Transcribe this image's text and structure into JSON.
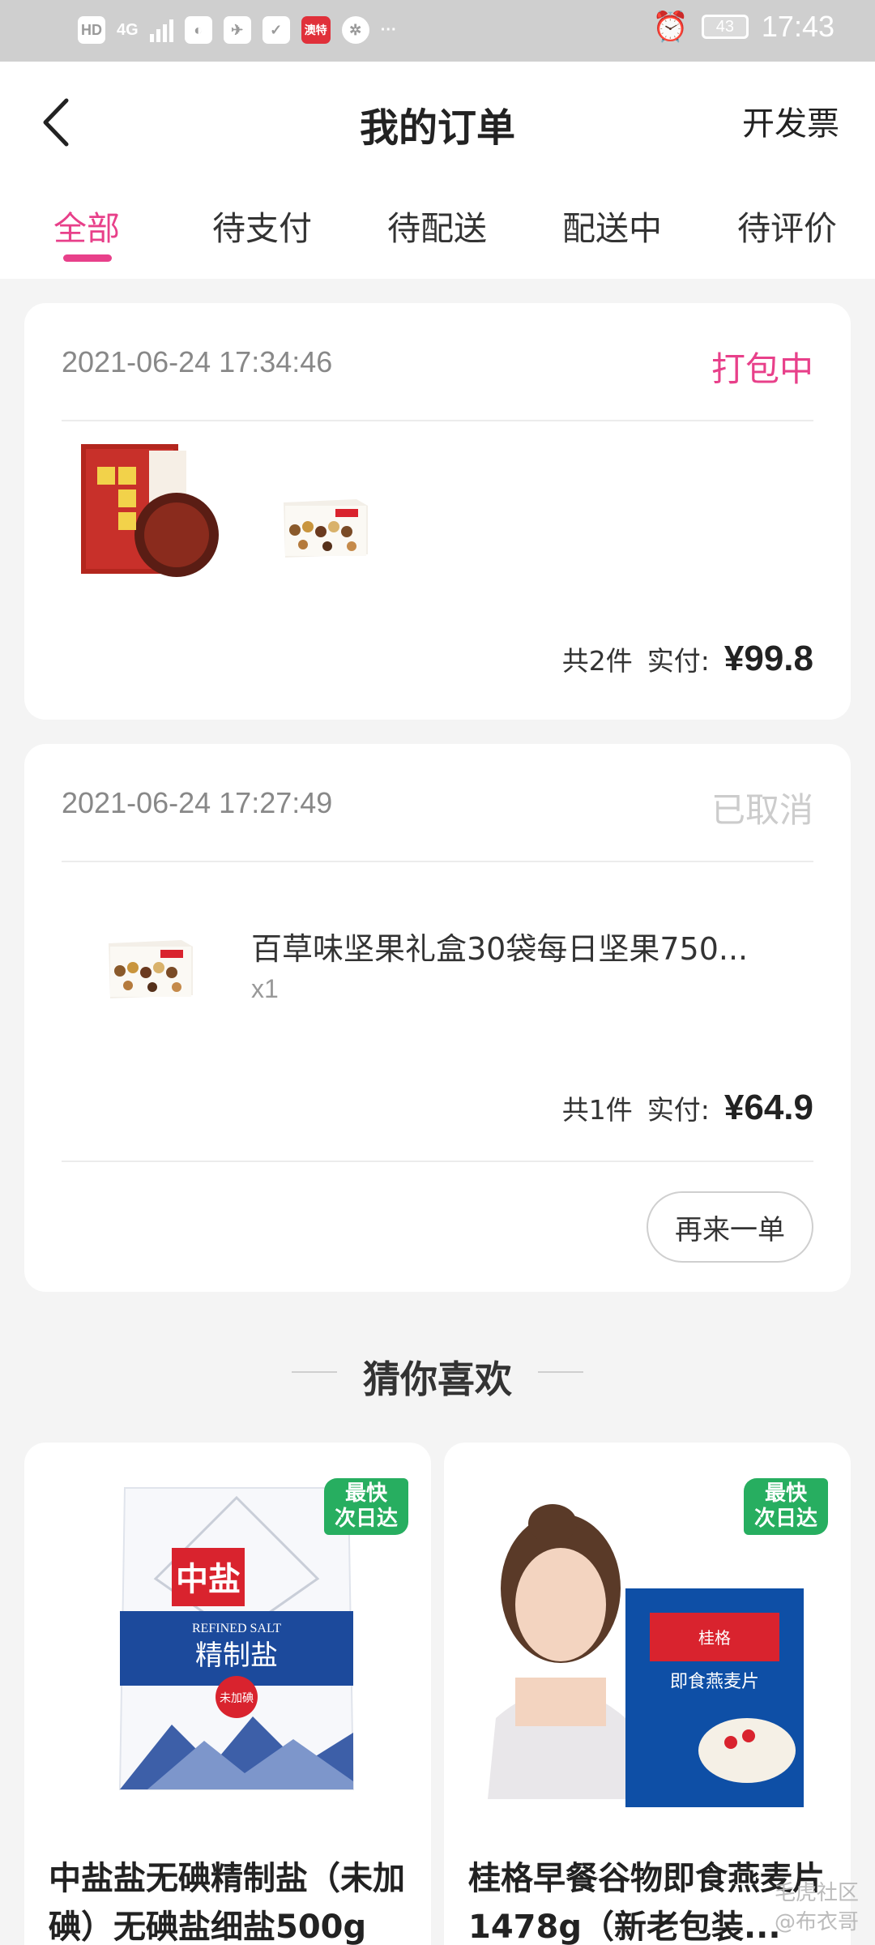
{
  "status_bar": {
    "hd": "HD",
    "network": "4G",
    "battery": "43",
    "time": "17:43",
    "app_badge": "澳特",
    "more": "···"
  },
  "header": {
    "title": "我的订单",
    "invoice": "开发票"
  },
  "tabs": [
    "全部",
    "待支付",
    "待配送",
    "配送中",
    "待评价"
  ],
  "orders": [
    {
      "time": "2021-06-24 17:34:46",
      "status": "打包中",
      "status_color": "#e8408a",
      "count_label": "共2件",
      "paid_label": "实付:",
      "price": "¥99.8"
    },
    {
      "time": "2021-06-24 17:27:49",
      "status": "已取消",
      "status_color": "#cccccc",
      "product_title": "百草味坚果礼盒30袋每日坚果750...",
      "qty": "x1",
      "count_label": "共1件",
      "paid_label": "实付:",
      "price": "¥64.9",
      "reorder_label": "再来一单"
    }
  ],
  "recommend": {
    "title": "猜你喜欢",
    "badge_line1": "最快",
    "badge_line2": "次日达",
    "items": [
      {
        "name": "中盐盐无碘精制盐（未加碘）无碘盐细盐500g",
        "package": {
          "brand": "中盐",
          "en": "REFINED SALT",
          "cn": "精制盐",
          "seal": "未加碘"
        }
      },
      {
        "name": "桂格早餐谷物即食燕麦片1478g（新老包装...",
        "package": {
          "brand": "桂格",
          "cn": "即食燕麦片"
        }
      }
    ]
  },
  "watermark": {
    "line1": "毛虎社区",
    "line2": "@布衣哥"
  },
  "accent": "#e8408a",
  "badge_color": "#27ae60"
}
